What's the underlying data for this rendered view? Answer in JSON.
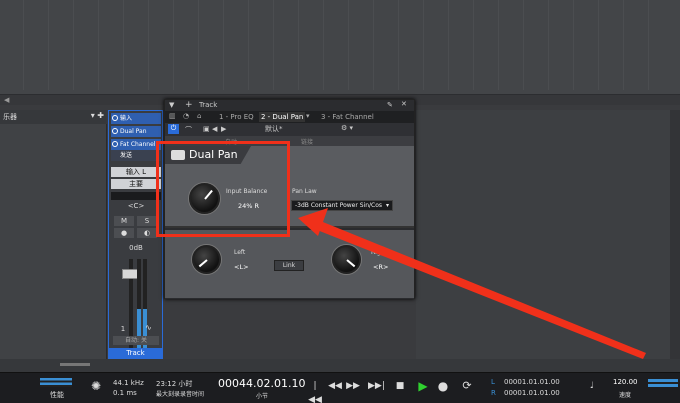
{
  "browser": {
    "label": "乐器"
  },
  "strip": {
    "input_label": "输入",
    "insert_label": "Dual Pan",
    "insert2_label": "Fat Channel",
    "send_label": "发送",
    "in_button": "输入 L",
    "main_button": "主要",
    "pan_value": "<C>",
    "m_label": "M",
    "s_label": "S",
    "gain_value": "0dB",
    "track_number": "1",
    "auto_label": "自动: 关",
    "track_name": "Track"
  },
  "plugin": {
    "window_title": "Track",
    "tabs": [
      "1 - Pro EQ",
      "2 - Dual Pan",
      "3 - Fat Channel"
    ],
    "preset": "默认*",
    "sub_labels": [
      "自动",
      "链接"
    ],
    "name": "Dual Pan",
    "input_balance_label": "Input Balance",
    "input_balance_value": "24% R",
    "pan_law_label": "Pan Law",
    "pan_law_value": "-3dB Constant Power Sin/Cos",
    "left_label": "Left",
    "left_value": "<L>",
    "link_label": "Link",
    "right_label": "Right",
    "right_value": "<R>"
  },
  "transport": {
    "perf_label": "性能",
    "sample_rate": "44.1 kHz",
    "latency": "0.1 ms",
    "record_time": "23:12 小时",
    "record_sub": "最大刻录录音时间",
    "position": "00044.02.01.10",
    "position_unit": "小节",
    "loop_l_marker": "L",
    "loop_r_marker": "R",
    "loop_l": "00001.01.01.00",
    "loop_r": "00001.01.01.00",
    "tempo": "120.00",
    "tempo_label": "速度"
  },
  "colors": {
    "accent": "#2a6bd8",
    "annotation": "#f0301a",
    "play": "#2fd12f"
  }
}
